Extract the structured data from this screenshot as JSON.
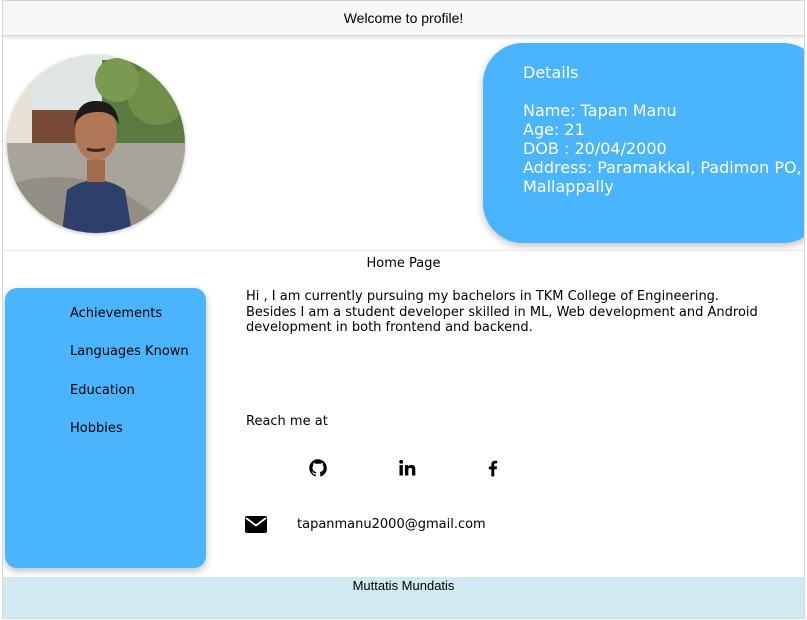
{
  "header": {
    "title": "Welcome to profile!"
  },
  "details": {
    "heading": "Details",
    "name": "Name: Tapan Manu",
    "age": "Age: 21",
    "dob": "DOB : 20/04/2000",
    "address_line1": "Address: Paramakkal, Padimon PO,",
    "address_line2": "Mallappally"
  },
  "home": {
    "title": "Home Page"
  },
  "sidebar": {
    "items": [
      {
        "label": "Achievements"
      },
      {
        "label": "Languages Known"
      },
      {
        "label": "Education"
      },
      {
        "label": "Hobbies"
      }
    ]
  },
  "intro": {
    "line1": "Hi , I am currently pursuing my bachelors in TKM College of Engineering.",
    "line2": "Besides I am a student developer skilled in ML, Web development and Android",
    "line3": "development in both frontend and backend."
  },
  "contact": {
    "reach_label": "Reach me at",
    "email": "tapanmanu2000@gmail.com",
    "icons": [
      "github-icon",
      "linkedin-icon",
      "facebook-icon",
      "envelope-icon"
    ]
  },
  "footer": {
    "text": "Muttatis Mundatis"
  },
  "colors": {
    "accent": "#4ab5fd",
    "footer_bg": "#d1e9f1",
    "header_bg": "#f7f7f7"
  }
}
